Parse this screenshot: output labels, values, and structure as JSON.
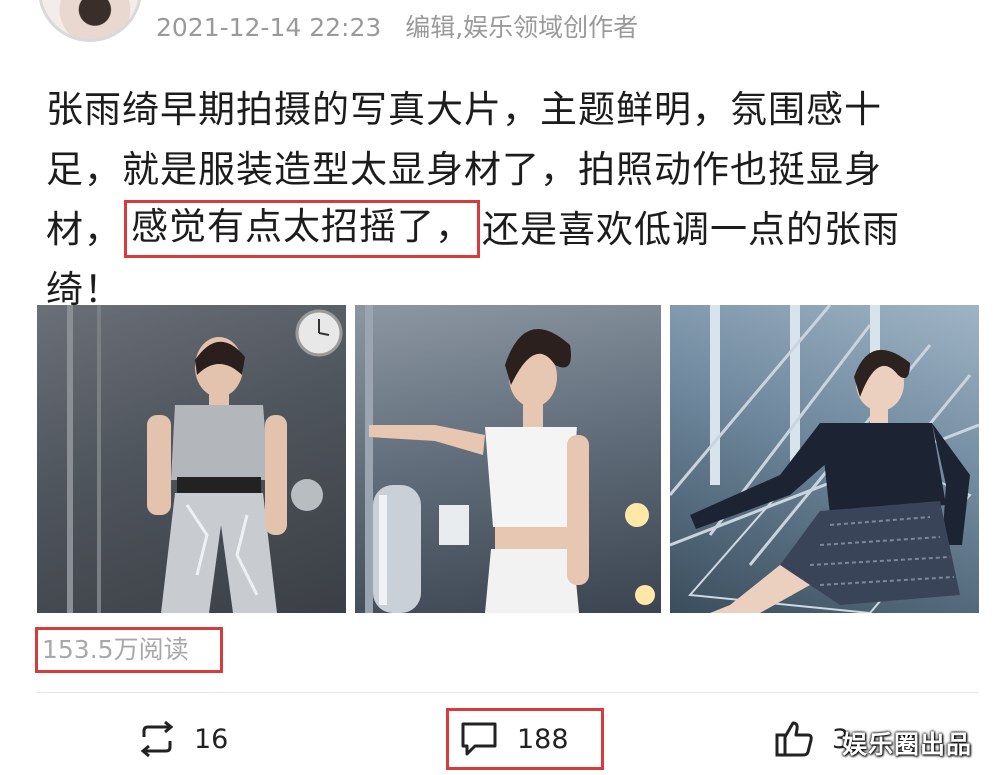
{
  "header": {
    "timestamp": "2021-12-14 22:23",
    "editor_label": "编辑,娱乐领域创作者"
  },
  "post": {
    "lines": [
      "张雨绮早期拍摄的写真大片，主题鲜明，氛围感十",
      "足，就是服装造型太显身材了，拍照动作也挺显身"
    ],
    "line3_before": "材，",
    "line3_highlight": "感觉有点太招摇了，",
    "line3_after": "还是喜欢低调一点的张雨",
    "line4": "绮！"
  },
  "photos": [
    {
      "subject": "woman in silver top and metallic pants"
    },
    {
      "subject": "woman in white top"
    },
    {
      "subject": "woman in dark outfit reclining"
    }
  ],
  "stats": {
    "reads": "153.5万阅读"
  },
  "actions": {
    "repost_count": "16",
    "comment_count": "188",
    "like_count": "3"
  },
  "icons": {
    "repost": "repost-icon",
    "comment": "comment-icon",
    "like": "thumbs-up-icon"
  },
  "watermark": "娱乐圈出品",
  "colors": {
    "highlight_border": "#d83b3b",
    "meta_text": "#9a9a9a",
    "reads_text": "#a8a8a8"
  }
}
